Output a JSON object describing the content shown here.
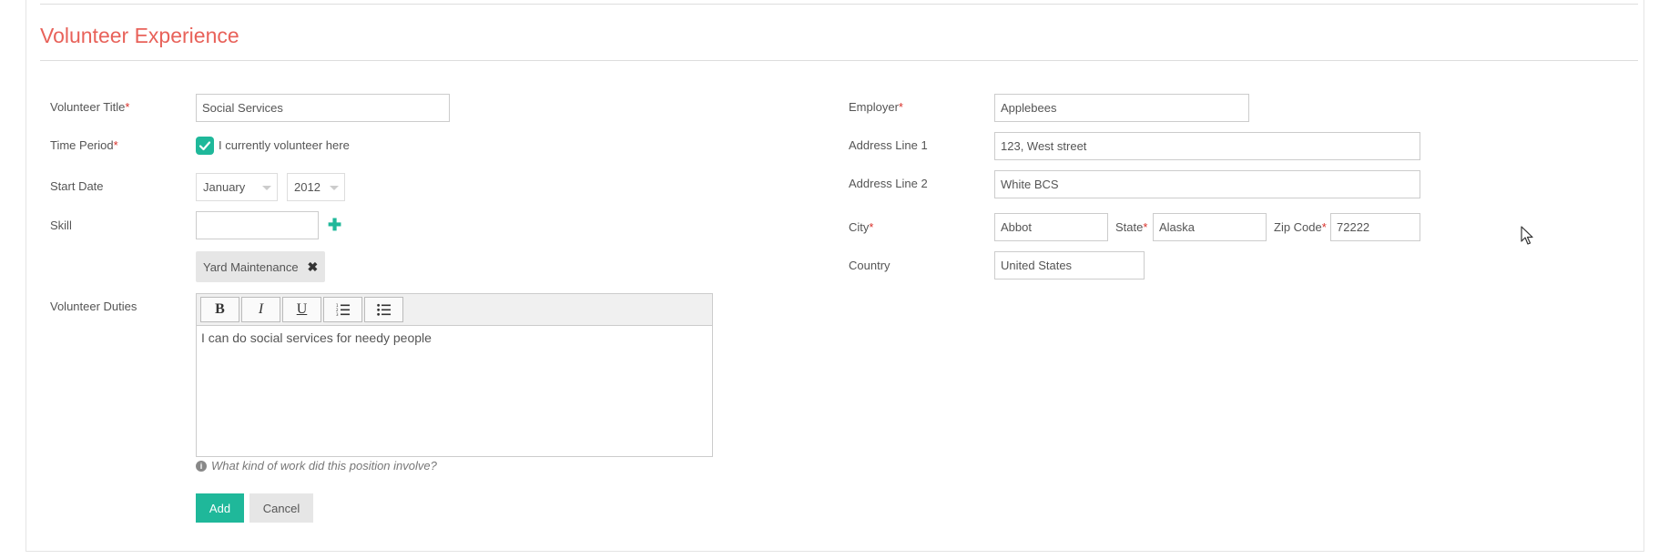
{
  "section": {
    "title": "Volunteer Experience"
  },
  "left": {
    "title_label": "Volunteer Title",
    "title_value": "Social Services",
    "time_period_label": "Time Period",
    "currently_label": "I currently volunteer here",
    "start_date_label": "Start Date",
    "start_month": "January",
    "start_year": "2012",
    "skill_label": "Skill",
    "skill_input": "",
    "skill_tag": "Yard Maintenance",
    "duties_label": "Volunteer Duties",
    "duties_text": "I can do social services for needy people",
    "duties_hint": "What kind of work did this position involve?",
    "toolbar": {
      "bold": "B",
      "italic": "I",
      "underline": "U"
    }
  },
  "right": {
    "employer_label": "Employer",
    "employer_value": "Applebees",
    "address1_label": "Address Line 1",
    "address1_value": "123, West street",
    "address2_label": "Address Line 2",
    "address2_value": "White BCS",
    "city_label": "City",
    "city_value": "Abbot",
    "state_label": "State",
    "state_value": "Alaska",
    "zip_label": "Zip Code",
    "zip_value": "72222",
    "country_label": "Country",
    "country_value": "United States"
  },
  "actions": {
    "add": "Add",
    "cancel": "Cancel"
  },
  "required_mark": "*",
  "colors": {
    "accent": "#1fb89a",
    "title": "#e8625a",
    "required": "#d9312b"
  }
}
